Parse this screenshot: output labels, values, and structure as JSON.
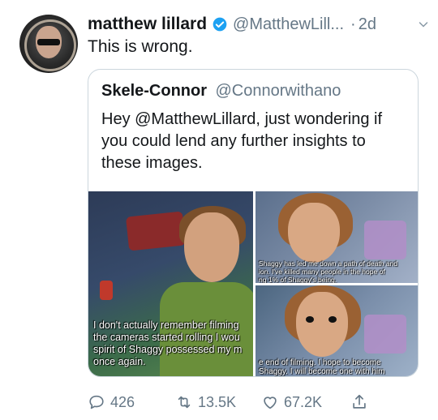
{
  "tweet": {
    "author_name": "matthew lillard",
    "author_handle": "@MatthewLill...",
    "separator": "·",
    "time": "2d",
    "text": "This is wrong."
  },
  "quoted_tweet": {
    "author_name": "Skele-Connor",
    "author_handle": "@Connorwithano",
    "text": "Hey @MatthewLillard, just wondering if you could lend any further insights to these images.",
    "images": [
      {
        "caption": "I don't actually remember filming\nthe cameras started rolling I wou\nspirit of Shaggy possessed my m\nonce again."
      },
      {
        "caption": "Shaggy has led me down a path of death and\nion. I've killed many people in the hope of\nng 1% of Shaggy's being."
      },
      {
        "caption": "e end of filming. I hope to become\nShaggy. I will become one with him"
      }
    ]
  },
  "actions": {
    "reply_count": "426",
    "retweet_count": "13.5K",
    "like_count": "67.2K"
  },
  "icons": [
    "avatar",
    "verified-icon",
    "chevron-down-icon",
    "reply-icon",
    "retweet-icon",
    "like-icon",
    "share-icon"
  ],
  "colors": {
    "verified": "#1da1f2",
    "muted": "#657786",
    "border": "#ccd6dd"
  }
}
